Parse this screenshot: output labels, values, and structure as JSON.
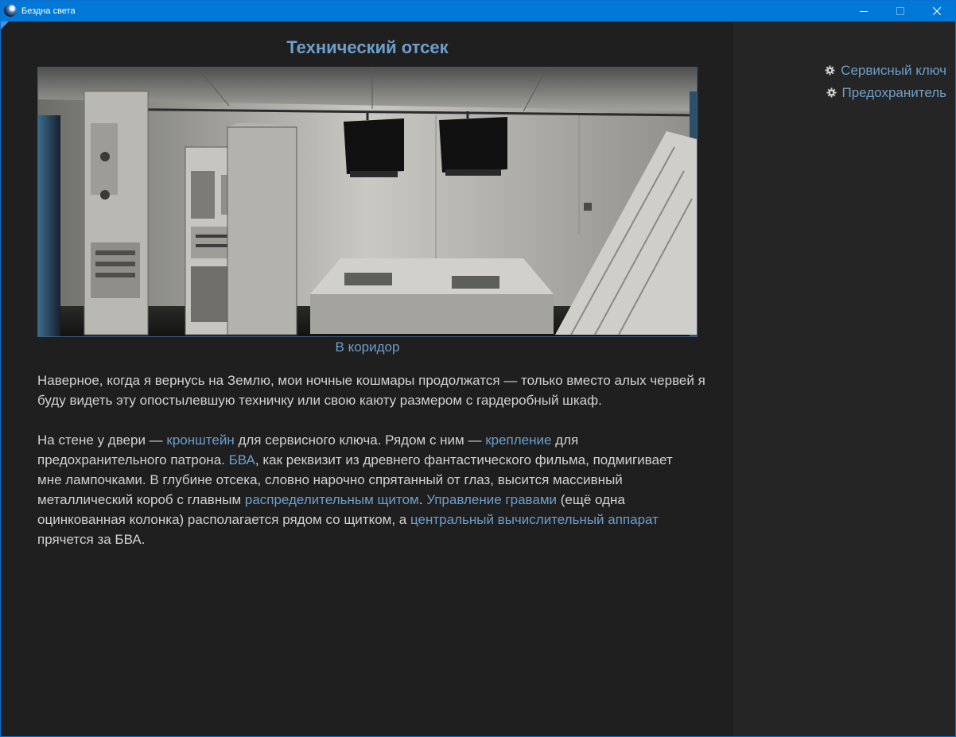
{
  "window": {
    "title": "Бездна света"
  },
  "location": {
    "title": "Технический отсек",
    "exit_link": "В коридор"
  },
  "paragraphs": {
    "p1": "Наверное, когда я вернусь на Землю, мои ночные кошмары продолжатся — только вместо алых червей я буду видеть эту опостылевшую техничку или свою каюту размером с гардеробный шкаф.",
    "p2": {
      "t1": "На стене у двери — ",
      "l1": "кронштейн",
      "t2": " для сервисного ключа. Рядом с ним — ",
      "l2": "крепление",
      "t3": " для предохранительного патрона. ",
      "l3": "БВА",
      "t4": ", как реквизит из древнего фантастического фильма, подмигивает мне лампочками. В глубине отсека, словно нарочно спрятанный от глаз, высится массивный металлический короб с главным ",
      "l4": "распределительным щитом",
      "t5": ". ",
      "l5": "Управление гравами",
      "t6": " (ещё одна оцинкованная колонка) располагается рядом со щитком, а ",
      "l6": "центральный вычислительный аппарат",
      "t7": " прячется за БВА."
    }
  },
  "inventory": [
    {
      "label": "Сервисный ключ",
      "icon": "gear-icon"
    },
    {
      "label": "Предохранитель",
      "icon": "gear-icon"
    }
  ],
  "colors": {
    "titlebar": "#0078d7",
    "link": "#6e9fcb",
    "text": "#d2d2d2",
    "background": "#1f1f1f",
    "sidebar": "#252525"
  }
}
